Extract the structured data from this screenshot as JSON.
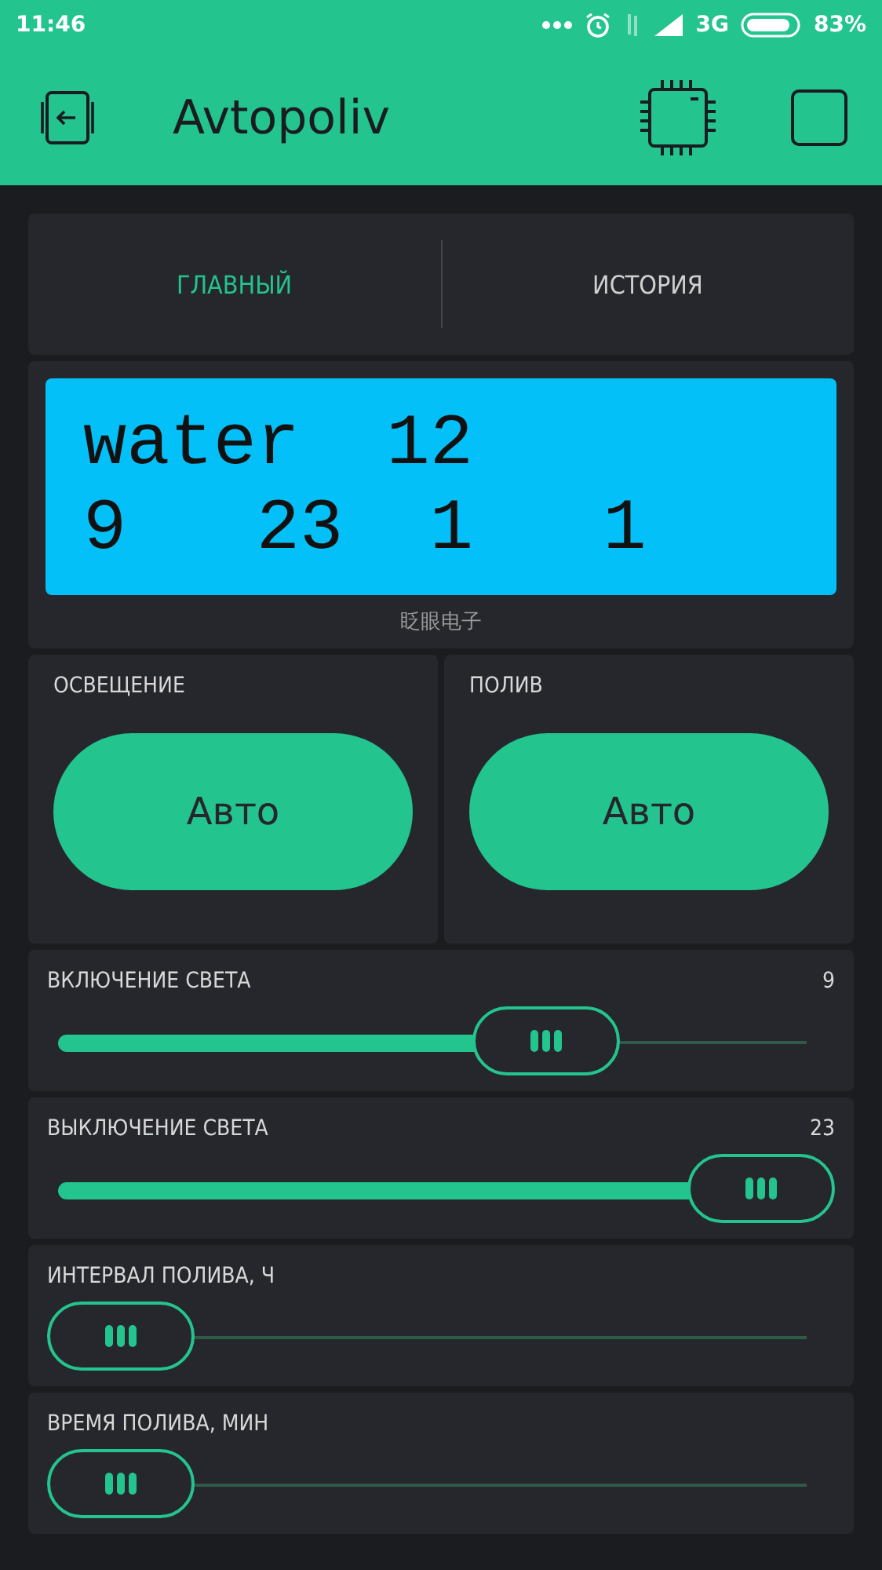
{
  "status_bar": {
    "time": "11:46",
    "network": "3G",
    "battery": "83%"
  },
  "header": {
    "title": "Avtopoliv"
  },
  "tabs": [
    {
      "label": "ГЛАВНЫЙ",
      "selected": true
    },
    {
      "label": "ИСТОРИЯ",
      "selected": false
    }
  ],
  "lcd": {
    "lines": [
      "water  12",
      "9   23  1   1"
    ],
    "caption": "眨眼电子"
  },
  "buttons": [
    {
      "label": "ОСВЕЩЕНИЕ",
      "value": "Авто"
    },
    {
      "label": "ПОЛИВ",
      "value": "Авто"
    }
  ],
  "sliders": [
    {
      "label": "ВКЛЮЧЕНИЕ СВЕТА",
      "reading": "9",
      "level": 0.665
    },
    {
      "label": "ВЫКЛЮЧЕНИЕ СВЕТА",
      "reading": "23",
      "level": 1
    },
    {
      "label": "ИНТЕРВАЛ ПОЛИВА, Ч",
      "level": 0
    },
    {
      "label": "ВРЕМЯ ПОЛИВА, МИН",
      "level": 0
    }
  ]
}
